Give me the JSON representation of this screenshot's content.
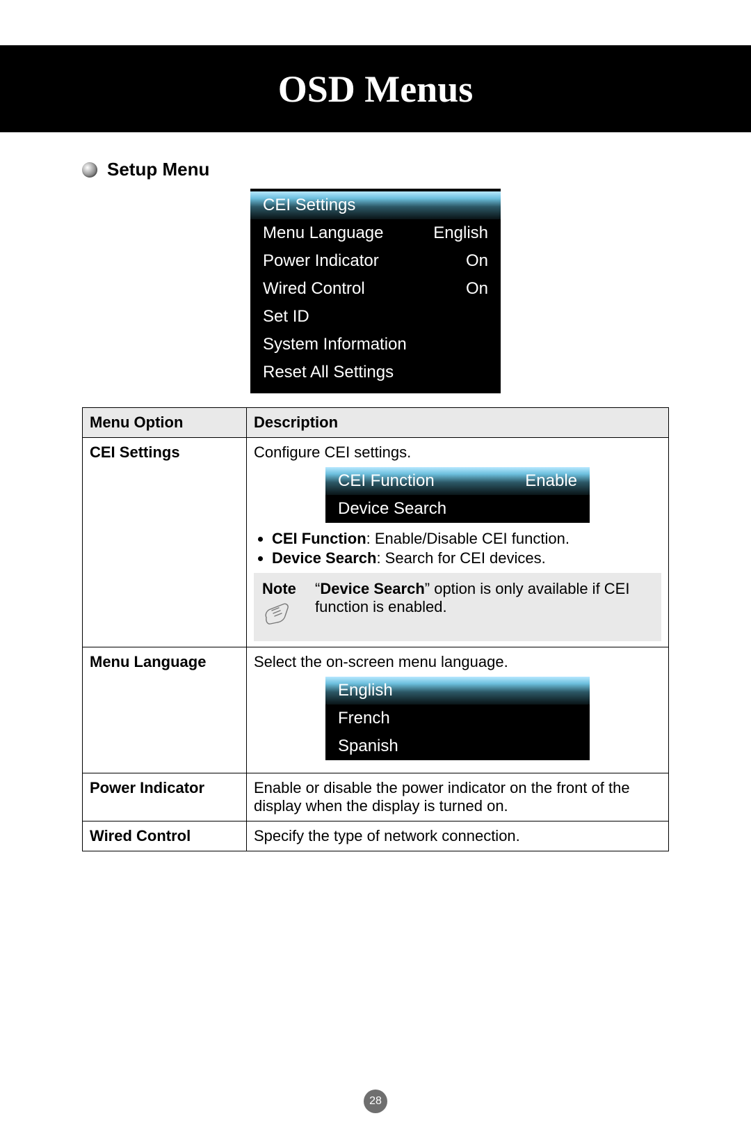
{
  "header": {
    "title": "OSD Menus"
  },
  "section": {
    "title": "Setup Menu"
  },
  "setup_menu": {
    "items": [
      {
        "label": "CEI Settings",
        "value": "",
        "highlight": true
      },
      {
        "label": "Menu Language",
        "value": "English",
        "highlight": false
      },
      {
        "label": "Power Indicator",
        "value": "On",
        "highlight": false
      },
      {
        "label": "Wired Control",
        "value": "On",
        "highlight": false
      },
      {
        "label": "Set ID",
        "value": "",
        "highlight": false
      },
      {
        "label": "System Information",
        "value": "",
        "highlight": false
      },
      {
        "label": "Reset All Settings",
        "value": "",
        "highlight": false
      }
    ]
  },
  "table": {
    "headers": {
      "option": "Menu Option",
      "description": "Description"
    },
    "rows": {
      "cei": {
        "option": "CEI Settings",
        "desc_intro": "Configure CEI settings.",
        "submenu": [
          {
            "label": "CEI Function",
            "value": "Enable",
            "highlight": true
          },
          {
            "label": "Device Search",
            "value": "",
            "highlight": false
          }
        ],
        "bullets": [
          {
            "bold": "CEI Function",
            "text": ": Enable/Disable CEI function."
          },
          {
            "bold": "Device Search",
            "text": ": Search for CEI devices."
          }
        ],
        "note": {
          "label": "Note",
          "bold_part": "Device Search",
          "prefix": "“",
          "suffix": "” option is only available if CEI function is enabled."
        }
      },
      "lang": {
        "option": "Menu Language",
        "desc_intro": "Select the on-screen menu language.",
        "submenu": [
          {
            "label": "English",
            "value": "",
            "highlight": true
          },
          {
            "label": "French",
            "value": "",
            "highlight": false
          },
          {
            "label": "Spanish",
            "value": "",
            "highlight": false
          }
        ]
      },
      "power": {
        "option": "Power Indicator",
        "desc": "Enable or disable the power indicator on the front of the display when the display is turned on."
      },
      "wired": {
        "option": "Wired Control",
        "desc": "Specify the type of network connection."
      }
    }
  },
  "page_number": "28"
}
